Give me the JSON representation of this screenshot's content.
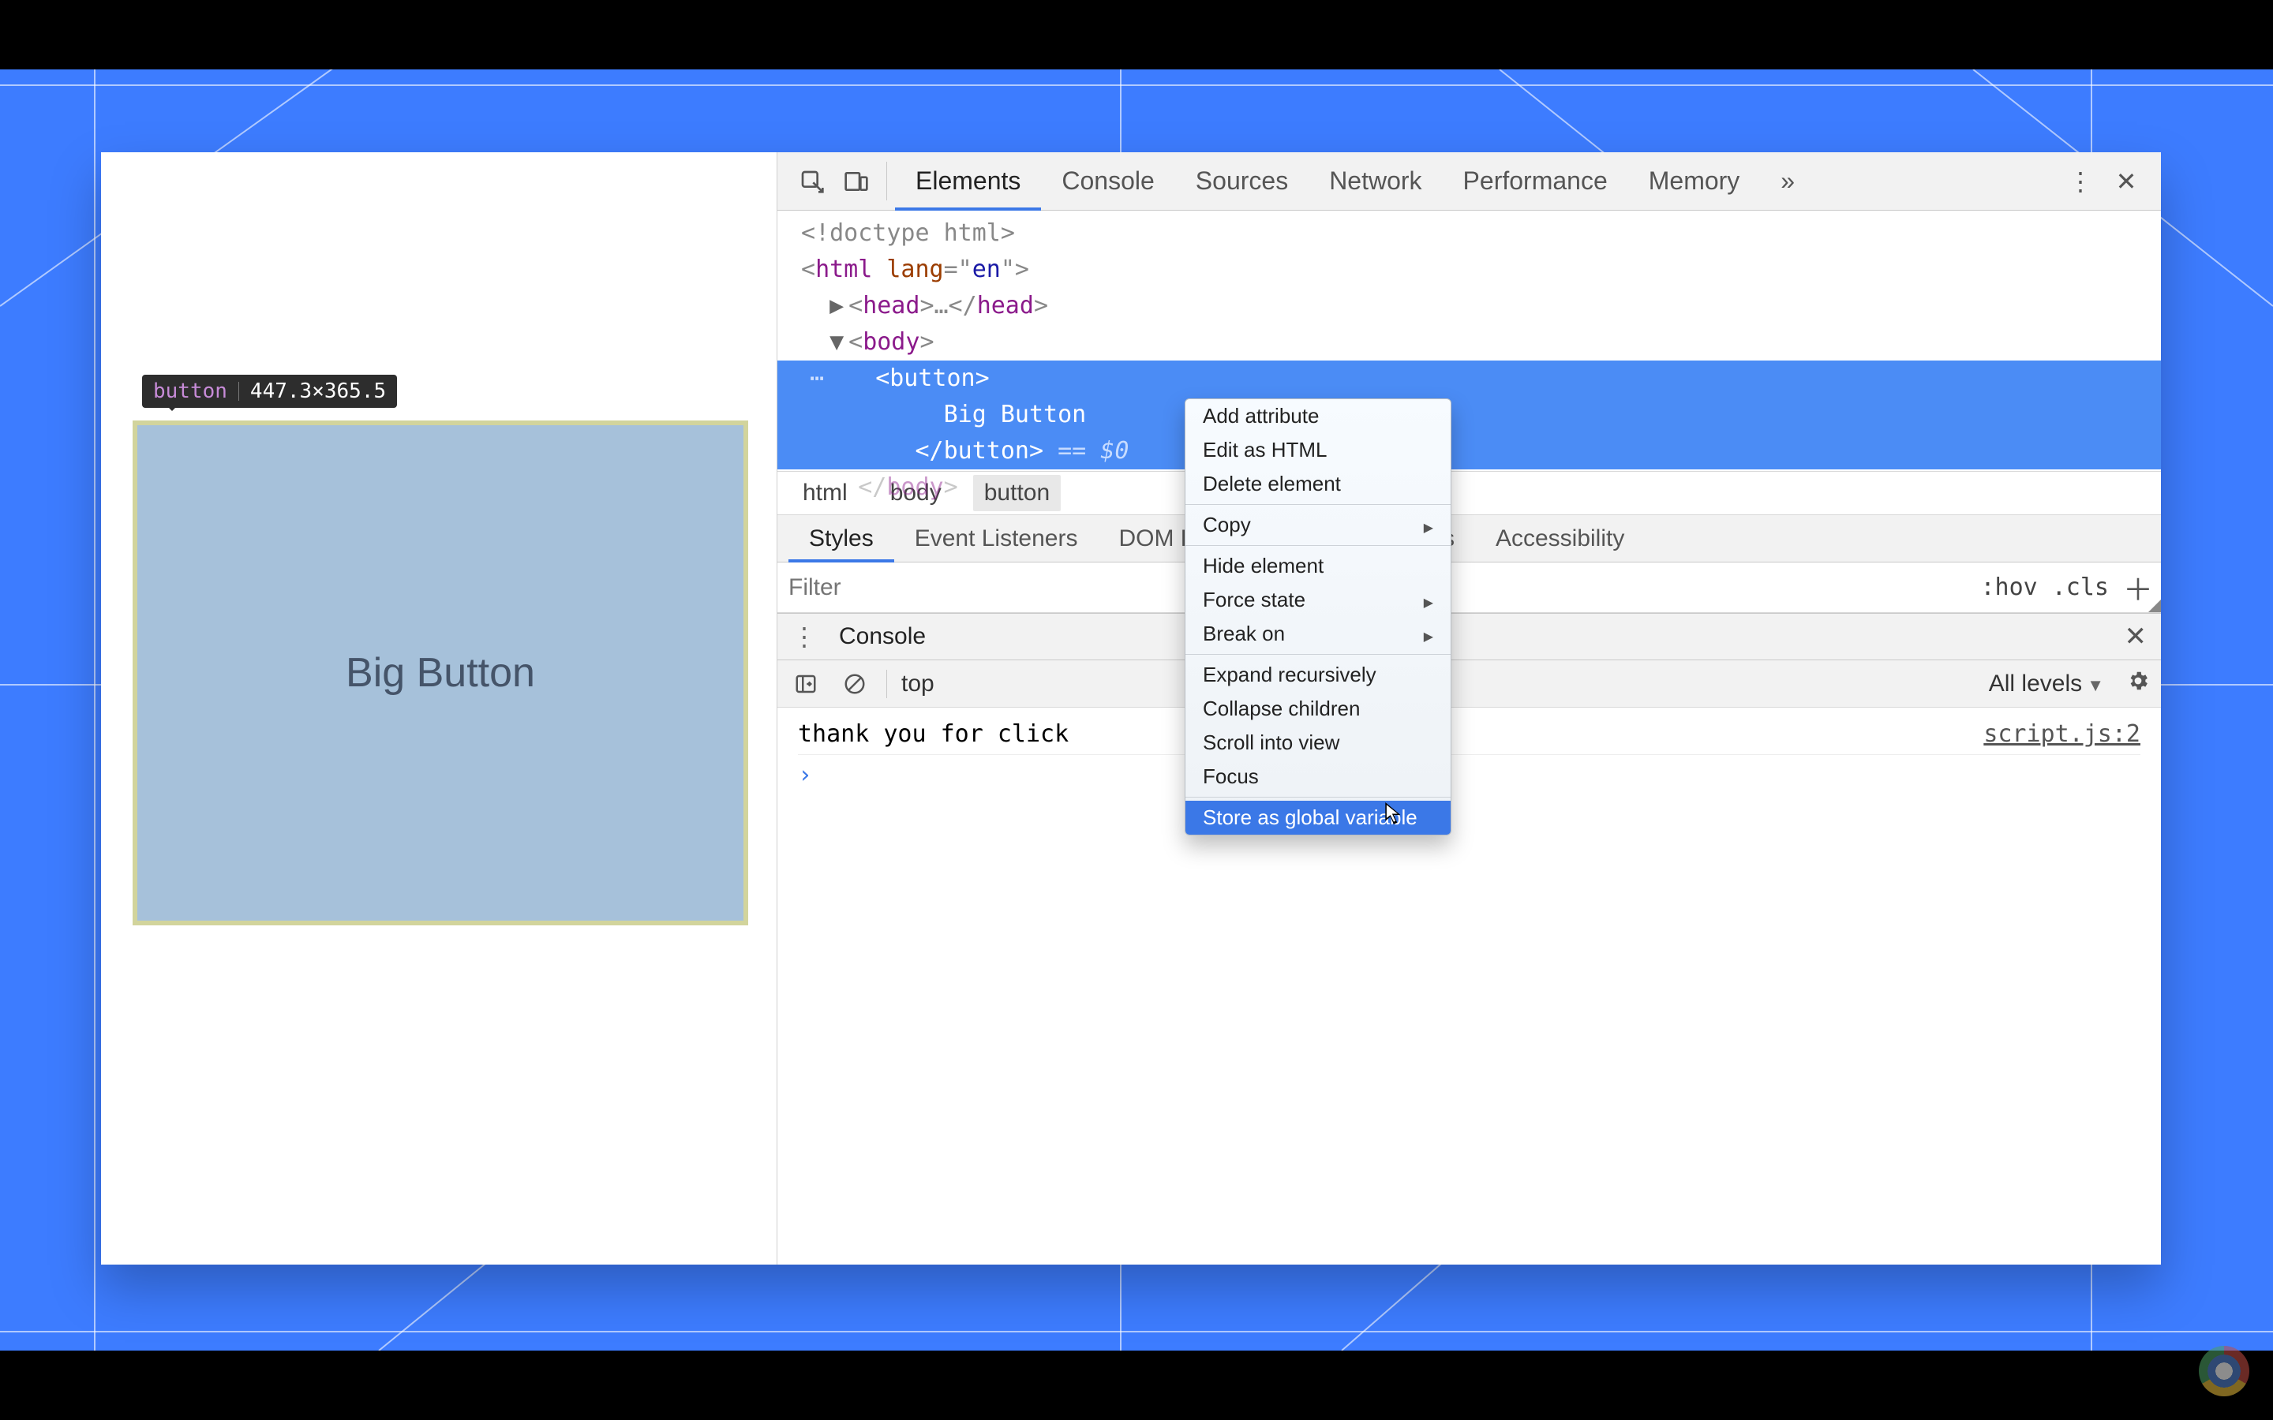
{
  "inspect_tip": {
    "tag": "button",
    "dims": "447.3×365.5"
  },
  "page": {
    "button_label": "Big Button"
  },
  "tabs": {
    "elements": "Elements",
    "console": "Console",
    "sources": "Sources",
    "network": "Network",
    "performance": "Performance",
    "memory": "Memory"
  },
  "dom": {
    "l1": "<!doctype html>",
    "l2_open": "<",
    "l2_tag": "html",
    "l2_attr": " lang",
    "l2_eq": "=\"",
    "l2_val": "en",
    "l2_close": "\">",
    "l3_open": "<",
    "l3_tag": "head",
    "l3_mid": ">…</",
    "l3_tag2": "head",
    "l3_end": ">",
    "l4_open": "<",
    "l4_tag": "body",
    "l4_end": ">",
    "sel_open": "<",
    "sel_tag": "button",
    "sel_end": ">",
    "sel_text": "Big Button",
    "sel_close_open": "</",
    "sel_close_tag": "button",
    "sel_close_end": ">",
    "eq0": " == $0",
    "l7_open": "</",
    "l7_tag": "body",
    "l7_end": ">"
  },
  "crumbs": {
    "html": "html",
    "body": "body",
    "button": "button"
  },
  "sub_tabs": {
    "styles": "Styles",
    "event_listeners": "Event Listeners",
    "dom_bp": "DOM Breakpoints",
    "properties": "Properties",
    "accessibility": "Accessibility"
  },
  "filter": {
    "placeholder": "Filter",
    "hov": ":hov",
    "cls": ".cls"
  },
  "drawer": {
    "label": "Console"
  },
  "console_toolbar": {
    "scope": "top",
    "levels": "All levels"
  },
  "console": {
    "msg": "thank you for click",
    "src": "script.js:2"
  },
  "ctx": {
    "add_attribute": "Add attribute",
    "edit_html": "Edit as HTML",
    "delete": "Delete element",
    "copy": "Copy",
    "hide": "Hide element",
    "force_state": "Force state",
    "break_on": "Break on",
    "expand": "Expand recursively",
    "collapse": "Collapse children",
    "scroll": "Scroll into view",
    "focus": "Focus",
    "store": "Store as global variable"
  }
}
